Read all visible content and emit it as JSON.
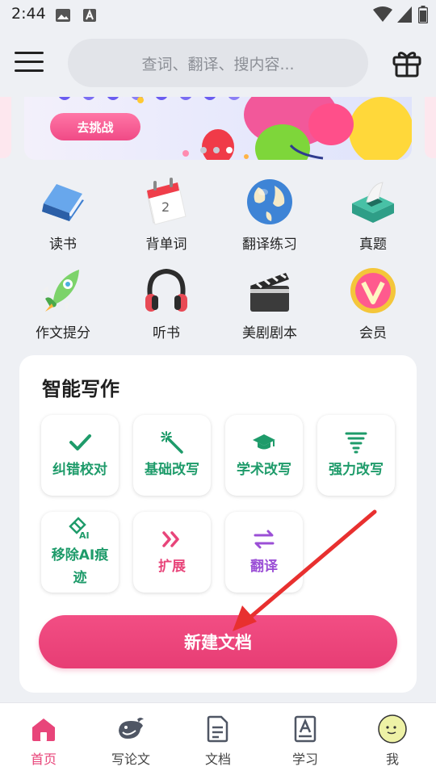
{
  "status_bar": {
    "time": "2:44"
  },
  "header": {
    "search_placeholder": "查词、翻译、搜内容..."
  },
  "banner": {
    "button_label": "去挑战"
  },
  "features": [
    {
      "label": "读书",
      "icon": "book-icon"
    },
    {
      "label": "背单词",
      "icon": "calendar-icon"
    },
    {
      "label": "翻译练习",
      "icon": "globe-icon"
    },
    {
      "label": "真题",
      "icon": "tissue-box-icon"
    },
    {
      "label": "作文提分",
      "icon": "rocket-icon"
    },
    {
      "label": "听书",
      "icon": "headphones-icon"
    },
    {
      "label": "美剧剧本",
      "icon": "clapperboard-icon"
    },
    {
      "label": "会员",
      "icon": "vip-badge-icon"
    }
  ],
  "smart_writing": {
    "title": "智能写作",
    "tools": [
      {
        "label": "纠错校对",
        "icon": "check-icon",
        "color": "#1e9b6a"
      },
      {
        "label": "基础改写",
        "icon": "magic-wand-icon",
        "color": "#1e9b6a"
      },
      {
        "label": "学术改写",
        "icon": "graduation-cap-icon",
        "color": "#1e9b6a"
      },
      {
        "label": "强力改写",
        "icon": "tornado-icon",
        "color": "#1e9b6a"
      },
      {
        "label": "移除AI痕迹",
        "icon": "ai-eraser-icon",
        "color": "#1e9b6a"
      },
      {
        "label": "扩展",
        "icon": "double-chevron-icon",
        "color": "#e8457a"
      },
      {
        "label": "翻译",
        "icon": "swap-arrows-icon",
        "color": "#9b4fd6"
      }
    ],
    "new_doc_label": "新建文档"
  },
  "bottom_nav": [
    {
      "label": "首页",
      "icon": "home-icon",
      "active": true
    },
    {
      "label": "写论文",
      "icon": "whale-icon",
      "active": false
    },
    {
      "label": "文档",
      "icon": "document-icon",
      "active": false
    },
    {
      "label": "学习",
      "icon": "study-icon",
      "active": false
    },
    {
      "label": "我",
      "icon": "avatar-icon",
      "active": false
    }
  ],
  "colors": {
    "accent": "#e8457a",
    "green": "#1e9b6a",
    "purple": "#9b4fd6"
  }
}
